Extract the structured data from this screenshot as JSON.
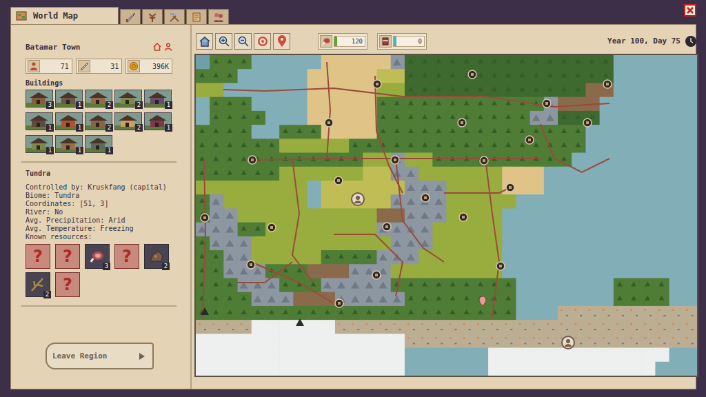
{
  "tabs": [
    {
      "label": "World Map",
      "selected": true
    },
    {
      "selected": false
    },
    {
      "selected": false
    },
    {
      "selected": false
    },
    {
      "selected": false
    },
    {
      "selected": false
    }
  ],
  "settlement": {
    "name": "Batamar Town",
    "stats": [
      {
        "value": "71"
      },
      {
        "value": "31"
      },
      {
        "value": "396K"
      }
    ],
    "buildings_label": "Buildings",
    "buildings": [
      {
        "count": "3"
      },
      {
        "count": "1"
      },
      {
        "count": "2"
      },
      {
        "count": "2"
      },
      {
        "count": "1"
      },
      {
        "count": "1"
      },
      {
        "count": "1"
      },
      {
        "count": "2"
      },
      {
        "count": "2"
      },
      {
        "count": "1"
      },
      {
        "count": "1"
      },
      {
        "count": "1"
      },
      {
        "count": "1"
      }
    ]
  },
  "region": {
    "name": "Tundra",
    "info": [
      "Controlled by: Kruskfang (capital)",
      "Biome: Tundra",
      "Coordinates: [51, 3]",
      "River: No",
      "Avg. Precipitation: Arid",
      "Avg. Temperature: Freezing"
    ],
    "resources_label": "Known resources:",
    "resources": [
      {
        "known": false,
        "label": "?"
      },
      {
        "known": false,
        "label": "?"
      },
      {
        "known": true,
        "count": "3"
      },
      {
        "known": false,
        "label": "?"
      },
      {
        "known": true,
        "count": "2"
      },
      {
        "known": true,
        "count": "2"
      },
      {
        "known": false,
        "label": "?"
      }
    ]
  },
  "leave_button": {
    "label": "Leave Region"
  },
  "meters": [
    {
      "value": "120",
      "level": 0.08,
      "color": "#5ea12e"
    },
    {
      "value": "0",
      "level": 0.08,
      "color": "#4fb3b3"
    }
  ],
  "date": "Year 100, Day 75"
}
